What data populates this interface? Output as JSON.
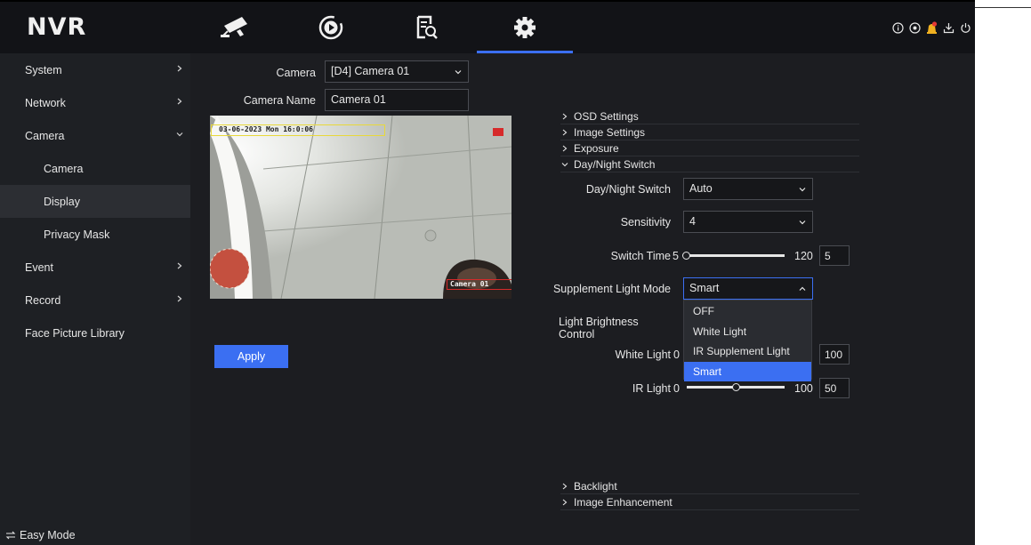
{
  "header": {
    "logo": "NVR",
    "tabs": [
      {
        "name": "live-view",
        "icon": "camera-icon",
        "active": false
      },
      {
        "name": "playback",
        "icon": "playback-icon",
        "active": false
      },
      {
        "name": "search",
        "icon": "file-search-icon",
        "active": false
      },
      {
        "name": "settings",
        "icon": "gear-icon",
        "active": true
      }
    ],
    "right_icons": [
      "info-icon",
      "status-icon",
      "alarm-icon",
      "download-icon",
      "power-icon"
    ],
    "accent_color": "#3b6ff2"
  },
  "sidebar": {
    "items": [
      {
        "label": "System",
        "chevron": "right"
      },
      {
        "label": "Network",
        "chevron": "right"
      },
      {
        "label": "Camera",
        "chevron": "down"
      },
      {
        "label": "Camera",
        "sub": true
      },
      {
        "label": "Display",
        "sub": true,
        "active": true
      },
      {
        "label": "Privacy Mask",
        "sub": true
      },
      {
        "label": "Event",
        "chevron": "right"
      },
      {
        "label": "Record",
        "chevron": "right"
      },
      {
        "label": "Face Picture Library"
      }
    ],
    "easy_mode": "Easy Mode"
  },
  "main": {
    "camera_label": "Camera",
    "camera_value": "[D4] Camera 01",
    "camera_name_label": "Camera Name",
    "camera_name_value": "Camera 01",
    "preview": {
      "osd_date": "03-06-2023 Mon 16:0:06",
      "osd_name": "Camera 01"
    },
    "apply_label": "Apply"
  },
  "settings": {
    "sections_top": [
      "OSD Settings",
      "Image Settings",
      "Exposure",
      "Day/Night Switch"
    ],
    "day_night_label": "Day/Night Switch",
    "day_night_value": "Auto",
    "sensitivity_label": "Sensitivity",
    "sensitivity_value": "4",
    "switch_time_label": "Switch Time",
    "switch_time_min": "5",
    "switch_time_max": "120",
    "switch_time_value": "5",
    "supplement_label": "Supplement Light Mode",
    "supplement_value": "Smart",
    "brightness_label": "Light Brightness Control",
    "white_light_label": "White Light",
    "white_light_min": "0",
    "white_light_value": "100",
    "ir_light_label": "IR Light",
    "ir_light_min": "0",
    "ir_light_max": "100",
    "ir_light_value": "50",
    "ir_light_level": 0.5,
    "dropdown_options": [
      "OFF",
      "White Light",
      "IR Supplement Light",
      "Smart"
    ],
    "dropdown_selected": "Smart",
    "sections_bottom": [
      "Backlight",
      "Image Enhancement"
    ]
  }
}
